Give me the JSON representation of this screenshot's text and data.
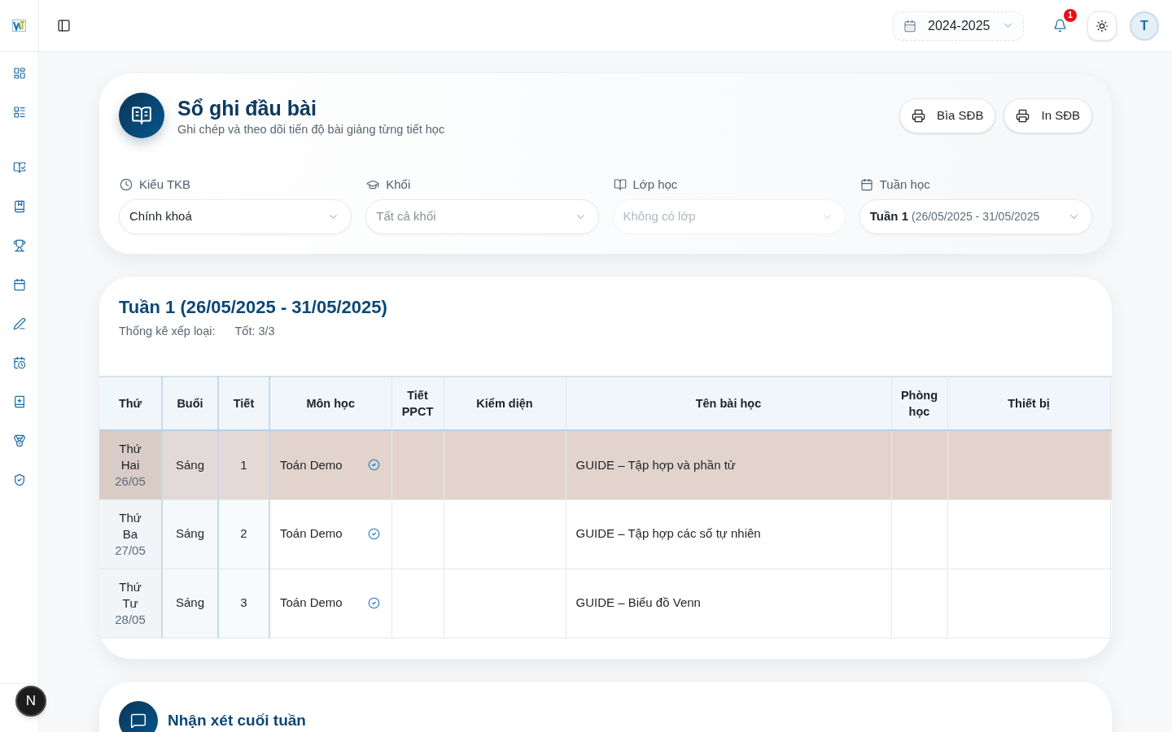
{
  "header": {
    "year_select": {
      "value": "2024-2025"
    },
    "notifications": {
      "count": "1"
    },
    "avatar": {
      "initial": "T"
    }
  },
  "page": {
    "title": "Sổ ghi đầu bài",
    "subtitle": "Ghi chép và theo dõi tiến độ bài giảng từng tiết học",
    "actions": [
      {
        "label": "Bìa SĐB"
      },
      {
        "label": "In SĐB"
      }
    ]
  },
  "filters": [
    {
      "label": "Kiểu TKB",
      "value": "Chính khoá",
      "disabled": false
    },
    {
      "label": "Khối",
      "placeholder": "Tất cả khối",
      "disabled": false
    },
    {
      "label": "Lớp học",
      "placeholder": "Không có lớp",
      "disabled": true
    },
    {
      "label": "Tuần học",
      "value": "Tuần 1",
      "value_detail": "(26/05/2025 - 31/05/2025",
      "disabled": false
    }
  ],
  "week": {
    "title": "Tuần 1 (26/05/2025 - 31/05/2025)",
    "stats_label": "Thống kê xếp loại:",
    "stats": [
      "Tốt: 3/3"
    ]
  },
  "table": {
    "columns": [
      "Thứ",
      "Buổi",
      "Tiết",
      "Môn học",
      "Tiết PPCT",
      "Kiểm diện",
      "Tên bài học",
      "Phòng học",
      "Thiết bị"
    ],
    "rows": [
      {
        "highlighted": true,
        "day": "Thứ Hai",
        "date": "26/05",
        "session": "Sáng",
        "period": "1",
        "subject": "Toán Demo",
        "confirmed": true,
        "lesson": "GUIDE – Tập hợp và phần tử"
      },
      {
        "highlighted": false,
        "day": "Thứ Ba",
        "date": "27/05",
        "session": "Sáng",
        "period": "2",
        "subject": "Toán Demo",
        "confirmed": true,
        "lesson": "GUIDE – Tập hợp các số tự nhiên"
      },
      {
        "highlighted": false,
        "day": "Thứ Tư",
        "date": "28/05",
        "session": "Sáng",
        "period": "3",
        "subject": "Toán Demo",
        "confirmed": true,
        "lesson": "GUIDE – Biểu đồ Venn"
      }
    ]
  },
  "weekly_comment": {
    "title": "Nhận xét cuối tuần"
  },
  "dev_indicator": {
    "label": "N"
  }
}
